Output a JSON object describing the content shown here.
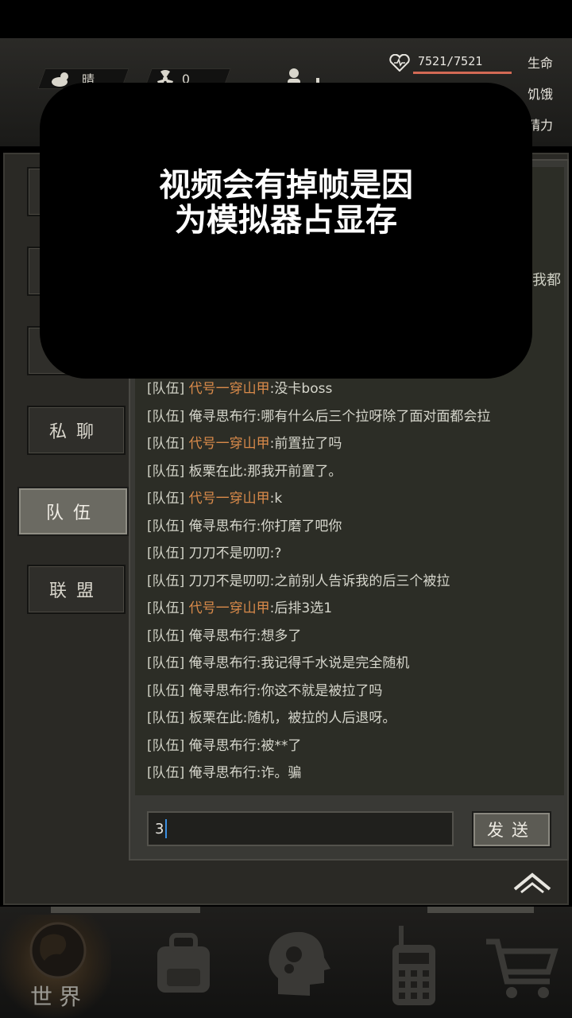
{
  "status": {
    "weather": {
      "icon": "cloud-sun-icon",
      "label": "晴"
    },
    "radiation": {
      "icon": "radiation-icon",
      "value": "0"
    },
    "player_icon": "person-icon",
    "hp": {
      "icon": "heart-icon",
      "text": "7521/7521",
      "fraction": 1.0
    },
    "labels": {
      "life": "生命",
      "hunger": "饥饿",
      "energy": "精力"
    }
  },
  "side_tabs": [
    {
      "label": "",
      "active": false
    },
    {
      "label": "",
      "active": false
    },
    {
      "label": "",
      "active": false
    },
    {
      "label": "私聊",
      "active": false
    },
    {
      "label": "队伍",
      "active": true
    },
    {
      "label": "联盟",
      "active": false
    }
  ],
  "chat": {
    "partial_text": "我都",
    "messages": [
      {
        "channel": "[队伍]",
        "name": "代号一穿山甲",
        "highlight": true,
        "text": ":没卡boss"
      },
      {
        "channel": "[队伍]",
        "name": "俺寻思布行",
        "highlight": false,
        "text": ":哪有什么后三个拉呀除了面对面都会拉"
      },
      {
        "channel": "[队伍]",
        "name": "代号一穿山甲",
        "highlight": true,
        "text": ":前置拉了吗"
      },
      {
        "channel": "[队伍]",
        "name": "板栗在此",
        "highlight": false,
        "text": ":那我开前置了。"
      },
      {
        "channel": "[队伍]",
        "name": "代号一穿山甲",
        "highlight": true,
        "text": ":k"
      },
      {
        "channel": "[队伍]",
        "name": "俺寻思布行",
        "highlight": false,
        "text": ":你打磨了吧你"
      },
      {
        "channel": "[队伍]",
        "name": "刀刀不是叨叨",
        "highlight": false,
        "text": ":?"
      },
      {
        "channel": "[队伍]",
        "name": "刀刀不是叨叨",
        "highlight": false,
        "text": ":之前别人告诉我的后三个被拉"
      },
      {
        "channel": "[队伍]",
        "name": "代号一穿山甲",
        "highlight": true,
        "text": ":后排3选1"
      },
      {
        "channel": "[队伍]",
        "name": "俺寻思布行",
        "highlight": false,
        "text": ":想多了"
      },
      {
        "channel": "[队伍]",
        "name": "俺寻思布行",
        "highlight": false,
        "text": ":我记得千水说是完全随机"
      },
      {
        "channel": "[队伍]",
        "name": "俺寻思布行",
        "highlight": false,
        "text": ":你这不就是被拉了吗"
      },
      {
        "channel": "[队伍]",
        "name": "板栗在此",
        "highlight": false,
        "text": ":随机，被拉的人后退呀。"
      },
      {
        "channel": "[队伍]",
        "name": "俺寻思布行",
        "highlight": false,
        "text": ":被**了"
      },
      {
        "channel": "[队伍]",
        "name": "俺寻思布行",
        "highlight": false,
        "text": ":诈。骗"
      }
    ],
    "input_value": "3",
    "send_label": "发送",
    "collapse_icon": "chevron-up-icon"
  },
  "bottom_nav": [
    {
      "label": "世界",
      "icon": "globe-icon"
    },
    {
      "label": "",
      "icon": "backpack-icon"
    },
    {
      "label": "",
      "icon": "brain-head-icon"
    },
    {
      "label": "",
      "icon": "walkie-talkie-icon"
    },
    {
      "label": "",
      "icon": "cart-icon"
    }
  ],
  "overlay": {
    "line1": "视频会有掉帧是因",
    "line2": "为模拟器占显存"
  },
  "colors": {
    "highlight_name": "#d98a4a",
    "hp_bar": "#d36a55",
    "input_caret": "#3a8ee0"
  }
}
